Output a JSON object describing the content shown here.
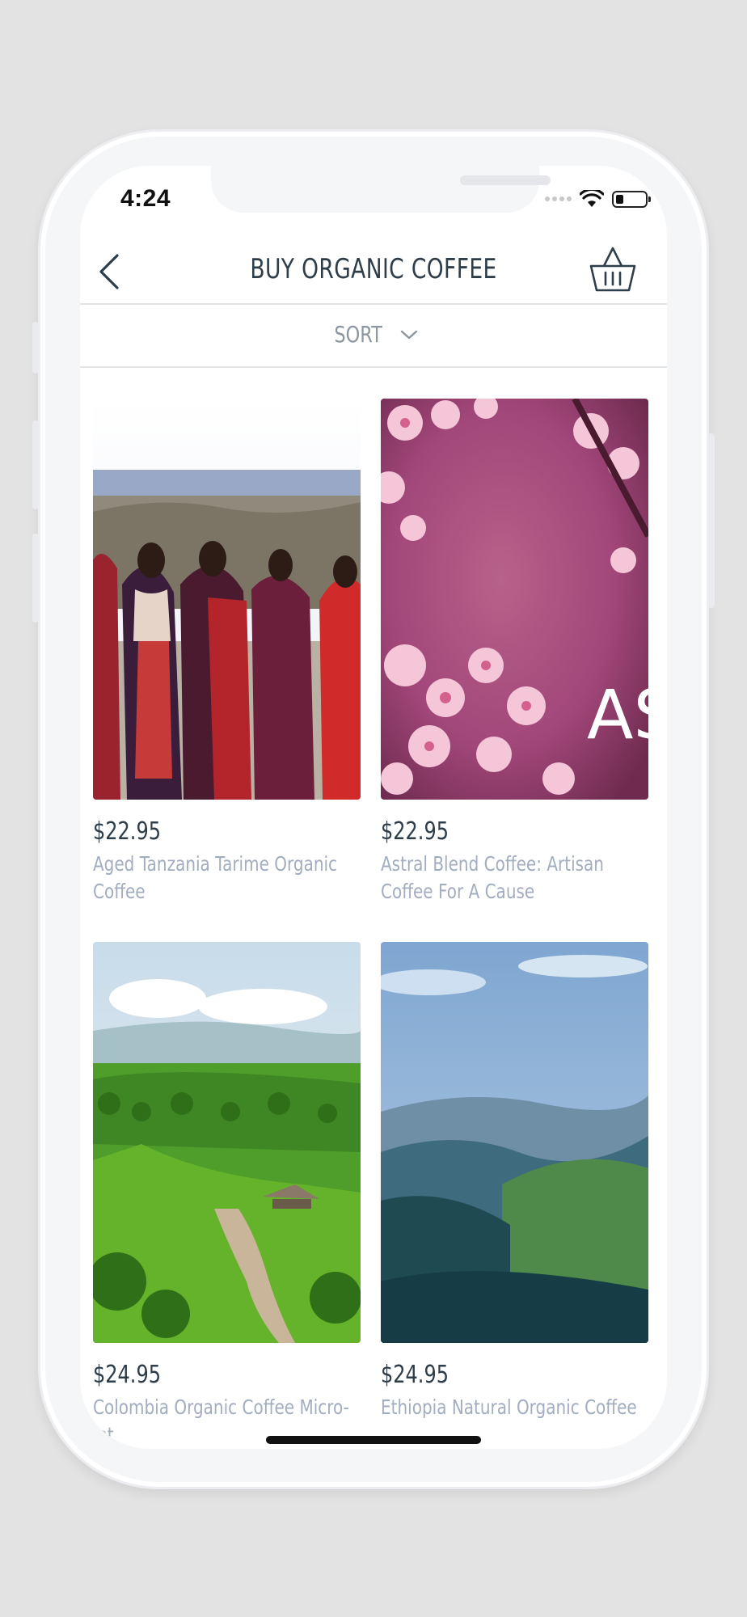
{
  "status_bar": {
    "time": "4:24",
    "icons": [
      "signal-icon",
      "wifi-icon",
      "battery-icon"
    ]
  },
  "header": {
    "title": "BUY ORGANIC COFFEE",
    "back_icon": "chevron-left-icon",
    "cart_icon": "basket-icon"
  },
  "sort": {
    "label": "SORT",
    "icon": "chevron-down-icon"
  },
  "products": [
    {
      "price": "$22.95",
      "name": "Aged Tanzania Tarime Organic Coffee",
      "image": "tanzania-people"
    },
    {
      "price": "$22.95",
      "name": "Astral Blend Coffee: Artisan Coffee For A Cause",
      "image": "cherry-blossom",
      "image_text": "AS"
    },
    {
      "price": "$24.95",
      "name": "Colombia Organic Coffee Micro-lot",
      "image": "green-hills"
    },
    {
      "price": "$24.95",
      "name": "Ethiopia Natural Organic Coffee",
      "image": "mountain-valley"
    }
  ],
  "colors": {
    "title": "#2e3d4a",
    "product_name": "#a3adc0",
    "divider": "#e3e5e8"
  }
}
